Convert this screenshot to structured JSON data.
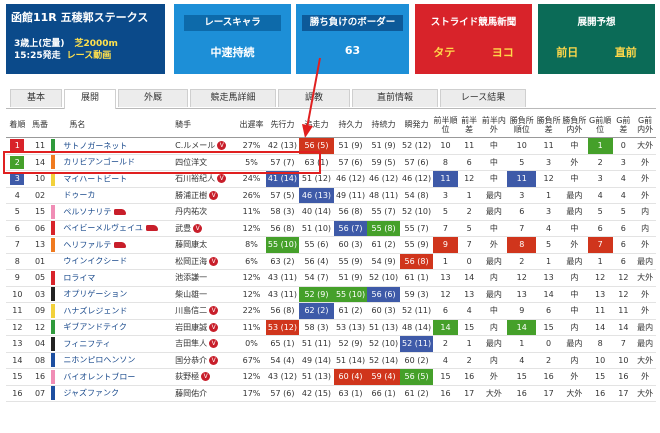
{
  "race": {
    "title": "函館11R 五稜郭ステークス",
    "condition": "3歳上(定量)",
    "distance": "芝2000m",
    "start": "15:25発走",
    "video_label": "レース動画"
  },
  "cards": {
    "chara": {
      "label": "レースキャラ",
      "value": "中速持続"
    },
    "border": {
      "label": "勝ち負けのボーダー",
      "value": "63"
    },
    "stride": {
      "label": "ストライド競馬新聞",
      "left": "タテ",
      "right": "ヨコ"
    },
    "pred": {
      "label": "展開予想",
      "left": "前日",
      "right": "直前"
    }
  },
  "tabs": [
    "基本",
    "展開",
    "外厩",
    "競走馬詳細",
    "調教",
    "直前情報",
    "レース結果"
  ],
  "active_tab": "展開",
  "headers": [
    "着順",
    "馬番",
    "馬名",
    "騎手",
    "出遅率",
    "先行力",
    "追走力",
    "持久力",
    "持続力",
    "瞬発力",
    "前半順位",
    "前半差",
    "前半内外",
    "勝負所順位",
    "勝負所差",
    "勝負所内外",
    "G前順位",
    "G前差",
    "G前内外"
  ],
  "rows": [
    {
      "rank": "1",
      "num": "11",
      "name": "サトノガーネット",
      "jockey": "C.ルメール",
      "late": "27%",
      "senko": "42 (13)",
      "tsuiso": "56 (5)",
      "jikyu": "51 (9)",
      "jizoku": "51 (9)",
      "shunpatsu": "52 (12)",
      "f_rank": "10",
      "f_diff": "11",
      "f_io": "中",
      "m_rank": "10",
      "m_diff": "11",
      "m_io": "中",
      "g_rank": "1",
      "g_diff": "0",
      "g_io": "大外"
    },
    {
      "rank": "2",
      "num": "14",
      "name": "カリビアンゴールド",
      "jockey": "四位洋文",
      "late": "5%",
      "senko": "57 (7)",
      "tsuiso": "63 (1)",
      "jikyu": "57 (6)",
      "jizoku": "59 (5)",
      "shunpatsu": "57 (6)",
      "f_rank": "8",
      "f_diff": "6",
      "f_io": "中",
      "m_rank": "5",
      "m_diff": "3",
      "m_io": "外",
      "g_rank": "2",
      "g_diff": "3",
      "g_io": "外"
    },
    {
      "rank": "3",
      "num": "10",
      "name": "マイハートビート",
      "jockey": "石川裕紀人",
      "late": "24%",
      "senko": "41 (14)",
      "tsuiso": "51 (12)",
      "jikyu": "46 (12)",
      "jizoku": "46 (12)",
      "shunpatsu": "46 (12)",
      "f_rank": "11",
      "f_diff": "12",
      "f_io": "中",
      "m_rank": "11",
      "m_diff": "12",
      "m_io": "中",
      "g_rank": "3",
      "g_diff": "4",
      "g_io": "外"
    },
    {
      "rank": "4",
      "num": "02",
      "name": "ドゥーカ",
      "jockey": "勝浦正樹",
      "late": "26%",
      "senko": "57 (5)",
      "tsuiso": "46 (13)",
      "jikyu": "49 (11)",
      "jizoku": "48 (11)",
      "shunpatsu": "54 (8)",
      "f_rank": "3",
      "f_diff": "1",
      "f_io": "最内",
      "m_rank": "3",
      "m_diff": "1",
      "m_io": "最内",
      "g_rank": "4",
      "g_diff": "4",
      "g_io": "外"
    },
    {
      "rank": "5",
      "num": "15",
      "name": "ペルソナリテ",
      "jockey": "丹内祐次",
      "late": "11%",
      "senko": "58 (3)",
      "tsuiso": "40 (14)",
      "jikyu": "56 (8)",
      "jizoku": "55 (7)",
      "shunpatsu": "52 (10)",
      "f_rank": "5",
      "f_diff": "2",
      "f_io": "最内",
      "m_rank": "6",
      "m_diff": "3",
      "m_io": "最内",
      "g_rank": "5",
      "g_diff": "5",
      "g_io": "内"
    },
    {
      "rank": "6",
      "num": "06",
      "name": "ベイビーメルヴェイユ",
      "jockey": "武豊",
      "late": "12%",
      "senko": "56 (8)",
      "tsuiso": "51 (10)",
      "jikyu": "56 (7)",
      "jizoku": "55 (8)",
      "shunpatsu": "55 (7)",
      "f_rank": "7",
      "f_diff": "5",
      "f_io": "中",
      "m_rank": "7",
      "m_diff": "4",
      "m_io": "中",
      "g_rank": "6",
      "g_diff": "6",
      "g_io": "内"
    },
    {
      "rank": "7",
      "num": "13",
      "name": "ヘリファルテ",
      "jockey": "藤岡康太",
      "late": "8%",
      "senko": "55 (10)",
      "tsuiso": "55 (6)",
      "jikyu": "60 (3)",
      "jizoku": "61 (2)",
      "shunpatsu": "55 (9)",
      "f_rank": "9",
      "f_diff": "7",
      "f_io": "外",
      "m_rank": "8",
      "m_diff": "5",
      "m_io": "外",
      "g_rank": "7",
      "g_diff": "6",
      "g_io": "外"
    },
    {
      "rank": "8",
      "num": "01",
      "name": "ウインイクシード",
      "jockey": "松岡正海",
      "late": "6%",
      "senko": "63 (2)",
      "tsuiso": "56 (4)",
      "jikyu": "55 (9)",
      "jizoku": "54 (9)",
      "shunpatsu": "56 (8)",
      "f_rank": "1",
      "f_diff": "0",
      "f_io": "最内",
      "m_rank": "2",
      "m_diff": "1",
      "m_io": "最内",
      "g_rank": "1",
      "g_diff": "6",
      "g_io": "最内"
    },
    {
      "rank": "9",
      "num": "05",
      "name": "ロライマ",
      "jockey": "池添謙一",
      "late": "12%",
      "senko": "43 (11)",
      "tsuiso": "54 (7)",
      "jikyu": "51 (9)",
      "jizoku": "52 (10)",
      "shunpatsu": "61 (1)",
      "f_rank": "13",
      "f_diff": "14",
      "f_io": "内",
      "m_rank": "12",
      "m_diff": "13",
      "m_io": "内",
      "g_rank": "12",
      "g_diff": "12",
      "g_io": "大外"
    },
    {
      "rank": "10",
      "num": "03",
      "name": "オプリゲーション",
      "jockey": "柴山雄一",
      "late": "12%",
      "senko": "43 (11)",
      "tsuiso": "52 (9)",
      "jikyu": "55 (10)",
      "jizoku": "56 (6)",
      "shunpatsu": "59 (3)",
      "f_rank": "12",
      "f_diff": "13",
      "f_io": "最内",
      "m_rank": "13",
      "m_diff": "14",
      "m_io": "中",
      "g_rank": "13",
      "g_diff": "12",
      "g_io": "外"
    },
    {
      "rank": "11",
      "num": "09",
      "name": "ハナズレジェンド",
      "jockey": "川島信二",
      "late": "22%",
      "senko": "56 (8)",
      "tsuiso": "62 (2)",
      "jikyu": "61 (2)",
      "jizoku": "60 (3)",
      "shunpatsu": "52 (11)",
      "f_rank": "6",
      "f_diff": "4",
      "f_io": "中",
      "m_rank": "9",
      "m_diff": "6",
      "m_io": "中",
      "g_rank": "11",
      "g_diff": "11",
      "g_io": "外"
    },
    {
      "rank": "12",
      "num": "12",
      "name": "ギブアンドテイク",
      "jockey": "岩田康誠",
      "late": "11%",
      "senko": "53 (12)",
      "tsuiso": "58 (3)",
      "jikyu": "53 (13)",
      "jizoku": "51 (13)",
      "shunpatsu": "48 (14)",
      "f_rank": "14",
      "f_diff": "15",
      "f_io": "内",
      "m_rank": "14",
      "m_diff": "15",
      "m_io": "内",
      "g_rank": "14",
      "g_diff": "14",
      "g_io": "最内"
    },
    {
      "rank": "13",
      "num": "04",
      "name": "フィニフティ",
      "jockey": "吉田隼人",
      "late": "0%",
      "senko": "65 (1)",
      "tsuiso": "51 (11)",
      "jikyu": "52 (9)",
      "jizoku": "52 (10)",
      "shunpatsu": "52 (11)",
      "f_rank": "2",
      "f_diff": "1",
      "f_io": "最内",
      "m_rank": "1",
      "m_diff": "0",
      "m_io": "最内",
      "g_rank": "8",
      "g_diff": "7",
      "g_io": "最内"
    },
    {
      "rank": "14",
      "num": "08",
      "name": "ニホンピロヘンソン",
      "jockey": "国分恭介",
      "late": "67%",
      "senko": "54 (4)",
      "tsuiso": "49 (14)",
      "jikyu": "51 (14)",
      "jizoku": "52 (14)",
      "shunpatsu": "60 (2)",
      "f_rank": "4",
      "f_diff": "2",
      "f_io": "内",
      "m_rank": "4",
      "m_diff": "2",
      "m_io": "内",
      "g_rank": "10",
      "g_diff": "10",
      "g_io": "大外"
    },
    {
      "rank": "15",
      "num": "16",
      "name": "バイオレントブロー",
      "jockey": "荻野極",
      "late": "12%",
      "senko": "43 (12)",
      "tsuiso": "51 (13)",
      "jikyu": "60 (4)",
      "jizoku": "59 (4)",
      "shunpatsu": "56 (5)",
      "f_rank": "15",
      "f_diff": "16",
      "f_io": "外",
      "m_rank": "15",
      "m_diff": "16",
      "m_io": "外",
      "g_rank": "15",
      "g_diff": "16",
      "g_io": "外"
    },
    {
      "rank": "16",
      "num": "07",
      "name": "ジャズファンク",
      "jockey": "藤岡佑介",
      "late": "17%",
      "senko": "57 (6)",
      "tsuiso": "42 (15)",
      "jikyu": "63 (1)",
      "jizoku": "66 (1)",
      "shunpatsu": "61 (2)",
      "f_rank": "16",
      "f_diff": "17",
      "f_io": "大外",
      "m_rank": "16",
      "m_diff": "17",
      "m_io": "大外",
      "g_rank": "16",
      "g_diff": "17",
      "g_io": "大外"
    }
  ],
  "colors": {
    "blue": "#3e5aa8",
    "green": "#45a02a",
    "red": "#d0351c",
    "gray": "#7a7a7a",
    "rank_top": "#d8232a",
    "rank_second": "#45a02a",
    "rank_third": "#3e5aa8"
  },
  "highlights": {
    "senko": {
      "3": "blue",
      "7": "green",
      "12": "red"
    },
    "tsuiso": {
      "1": "red",
      "4": "blue",
      "10": "green",
      "11": "blue"
    },
    "jikyu": {
      "6": "blue",
      "10": "green",
      "15": "red"
    },
    "jizoku": {
      "6": "green",
      "10": "blue",
      "15": "red"
    },
    "shunpatsu": {
      "8": "red",
      "13": "blue",
      "15": "green"
    },
    "f_rank": {
      "3": "blue",
      "7": "red",
      "12": "green"
    },
    "m_rank": {
      "3": "blue",
      "7": "red",
      "12": "green"
    },
    "g_rank": {
      "1": "green",
      "7": "red"
    }
  },
  "jockey_badges": [
    1,
    3,
    4,
    6,
    8,
    11,
    12,
    13,
    14,
    15
  ],
  "horse_caps": [
    5,
    6,
    7
  ],
  "frame_colors": [
    "#ffffff",
    "#ffffff",
    "#222222",
    "#222222",
    "#d8232a",
    "#d8232a",
    "#1d4fa0",
    "#1d4fa0",
    "#f2d13b",
    "#f2d13b",
    "#2f9a3b",
    "#2f9a3b",
    "#f07a1f",
    "#f07a1f",
    "#f08db5",
    "#f08db5"
  ]
}
